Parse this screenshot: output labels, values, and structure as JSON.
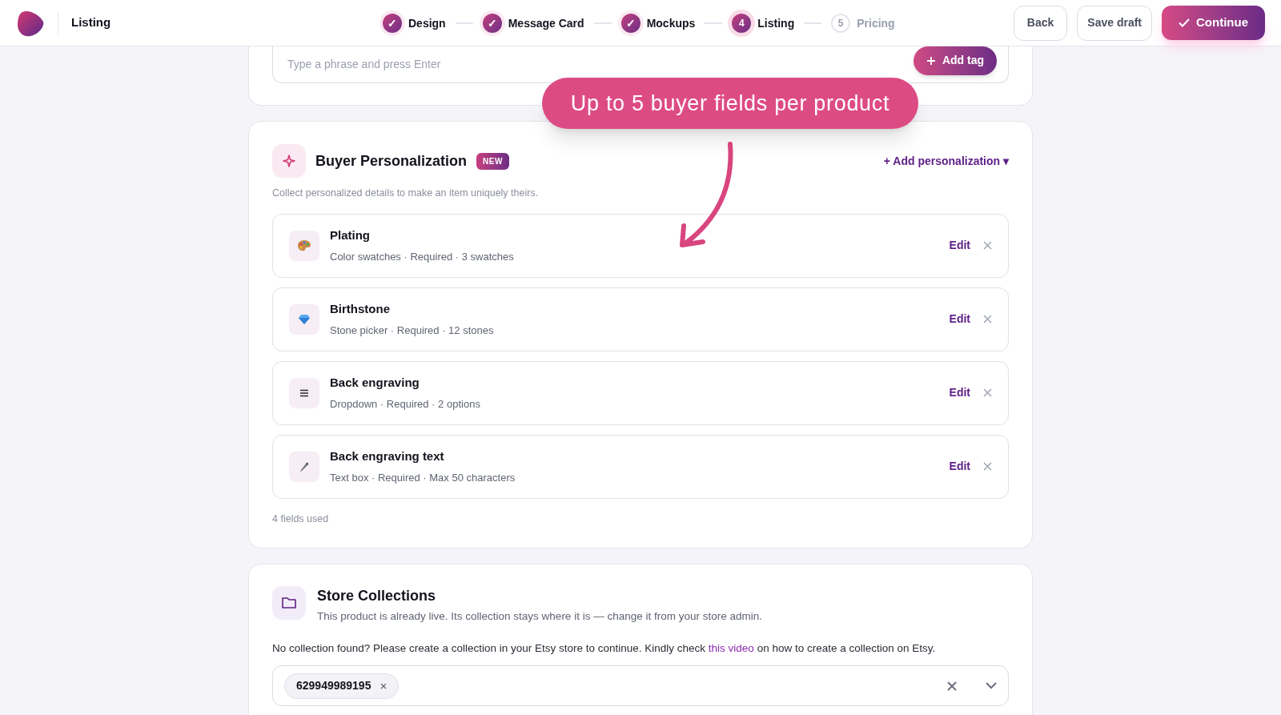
{
  "header": {
    "title": "Listing"
  },
  "steps": [
    {
      "marker": "✓",
      "label": "Design",
      "done": true,
      "selected": false
    },
    {
      "marker": "✓",
      "label": "Message Card",
      "done": true,
      "selected": false
    },
    {
      "marker": "✓",
      "label": "Mockups",
      "done": true,
      "selected": false
    },
    {
      "marker": "4",
      "label": "Listing",
      "done": false,
      "selected": true
    },
    {
      "marker": "5",
      "label": "Pricing",
      "done": false,
      "selected": false
    }
  ],
  "actions": {
    "back": "Back",
    "save": "Save draft",
    "continue": "Continue"
  },
  "tags": {
    "placeholder": "Type a phrase and press Enter",
    "add_button": "Add tag"
  },
  "callout": {
    "text": "Up to 5 buyer fields per product"
  },
  "personalization": {
    "title": "Buyer Personalization",
    "badge": "NEW",
    "add_link": "+ Add personalization ▾",
    "subtitle": "Collect personalized details to make an item uniquely theirs.",
    "fields": [
      {
        "kind": "swatches",
        "name": "Plating",
        "details": "Color swatches · Required · 3 swatches",
        "edit": "Edit"
      },
      {
        "kind": "stones",
        "name": "Birthstone",
        "details": "Stone picker · Required · 12 stones",
        "edit": "Edit"
      },
      {
        "kind": "dropdown",
        "name": "Back engraving",
        "details": "Dropdown · Required · 2 options",
        "edit": "Edit"
      },
      {
        "kind": "text",
        "name": "Back engraving text",
        "details": "Text box · Required · Max 50 characters",
        "edit": "Edit"
      }
    ],
    "footer": "4 fields used"
  },
  "collections": {
    "title": "Store Collections",
    "subtitle": "This product is already live. Its collection stays where it is — change it from your store admin.",
    "note_before": "No collection found? Please create a collection in your Etsy store to continue. Kindly check",
    "link": "this video",
    "note_after": "on how to create a collection on Etsy.",
    "selected": [
      "629949989195"
    ]
  }
}
